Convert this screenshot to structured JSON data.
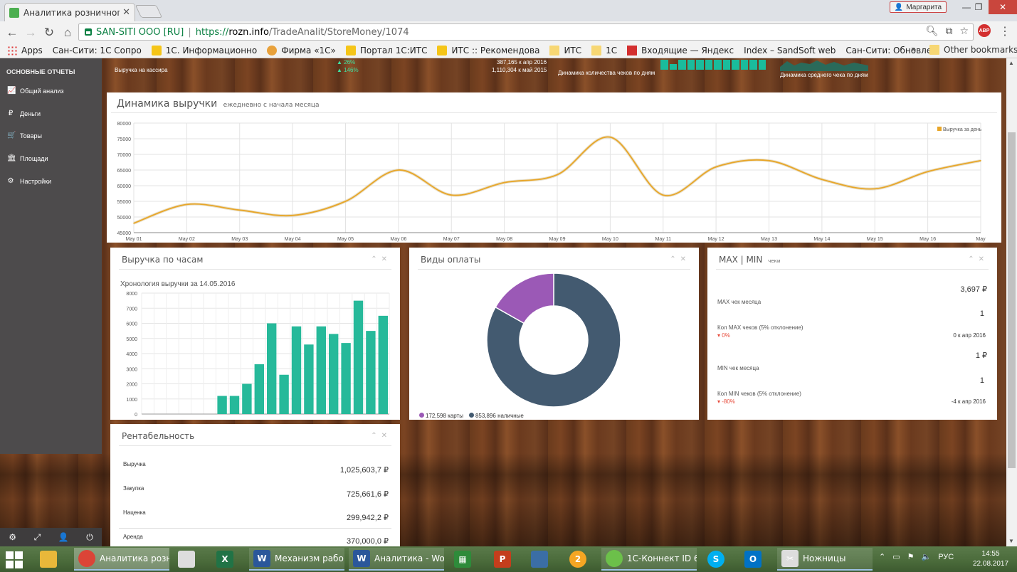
{
  "browser": {
    "tab_title": "Аналитика розничного",
    "user_name": "Маргарита",
    "site_identity": "SAN-SITI OOO [RU]",
    "url_protocol": "https://",
    "url_host": "rozn.info",
    "url_path": "/TradeAnalit/StoreMoney/1074",
    "bookmarks": [
      {
        "label": "Apps",
        "icon": "apps-icon"
      },
      {
        "label": "Сан-Сити: 1С Сопро",
        "icon": "page-icon"
      },
      {
        "label": "1С. Информационно",
        "icon": "its-icon"
      },
      {
        "label": "Фирма «1С»",
        "icon": "firm-icon"
      },
      {
        "label": "Портал 1С:ИТС",
        "icon": "its-icon"
      },
      {
        "label": "ИТС :: Рекомендова",
        "icon": "its-icon"
      },
      {
        "label": "ИТС",
        "icon": "folder-icon"
      },
      {
        "label": "1С",
        "icon": "folder-icon"
      },
      {
        "label": "Входящие — Яндекс",
        "icon": "mail-icon"
      },
      {
        "label": "Index – SandSoft web",
        "icon": "page-icon"
      },
      {
        "label": "Сан-Сити: Обновлен",
        "icon": "page-icon"
      }
    ],
    "more_label": "»",
    "other_bookmarks": "Other bookmarks"
  },
  "sidebar": {
    "title": "ОСНОВНЫЕ ОТЧЕТЫ",
    "items": [
      {
        "label": "Общий анализ",
        "icon": "chart-line-icon",
        "glyph": "📈"
      },
      {
        "label": "Деньги",
        "icon": "ruble-icon",
        "glyph": "₽"
      },
      {
        "label": "Товары",
        "icon": "cart-icon",
        "glyph": "🛒"
      },
      {
        "label": "Площади",
        "icon": "building-icon",
        "glyph": "🏛"
      },
      {
        "label": "Настройки",
        "icon": "gear-icon",
        "glyph": "⚙"
      }
    ],
    "bottom_icons": [
      "gear-icon",
      "fullscreen-icon",
      "user-icon",
      "power-icon"
    ]
  },
  "kpi": {
    "revenue_cashier_label": "Выручка на кассира",
    "pct1": "▲ 26%",
    "pct2": "▲ 146%",
    "cmp1": "387,165 к апр 2016",
    "cmp2": "1,110,304 к май 2015",
    "checks_label": "Динамика количества чеков по дням",
    "avg_check_label": "Динамика среднего чека по дням"
  },
  "revenue_chart": {
    "title": "Динамика выручки",
    "subtitle": "ежедневно с начала месяца"
  },
  "hourly_panel": {
    "title": "Выручка по часам",
    "chart_title": "Хронология выручки за 14.05.2016"
  },
  "payment_panel": {
    "title": "Виды оплаты",
    "legend": [
      {
        "label": "172,598 карты",
        "color": "#9b59b6"
      },
      {
        "label": "853,896 наличные",
        "color": "#435a70"
      }
    ]
  },
  "maxmin_panel": {
    "title": "MAX | MIN",
    "subtitle": "чеки",
    "max_value": "3,697 ₽",
    "max_label": "MAX чек месяца",
    "max_count": "1",
    "max_count_label": "Кол MAX чеков (5% отклонение)",
    "max_delta": "▾ 0%",
    "max_cmp": "0 к апр 2016",
    "min_value": "1 ₽",
    "min_label": "MIN чек месяца",
    "min_count": "1",
    "min_count_label": "Кол MIN чеков (5% отклонение)",
    "min_delta": "▾ -80%",
    "min_cmp": "-4 к апр 2016"
  },
  "rent_panel": {
    "title": "Рентабельность",
    "rows": [
      {
        "label": "Выручка",
        "value": "1,025,603,7 ₽"
      },
      {
        "label": "Закупка",
        "value": "725,661,6 ₽"
      },
      {
        "label": "Наценка",
        "value": "299,942,2 ₽"
      },
      {
        "label": "Аренда",
        "value": "370,000,0 ₽"
      }
    ]
  },
  "taskbar": {
    "items": [
      {
        "label": "Аналитика розн...",
        "icon": "chrome-icon",
        "color": "#db4437"
      },
      {
        "label": "Механизм рабо...",
        "icon": "word-icon",
        "color": "#2b579a"
      },
      {
        "label": "Аналитика - Wo...",
        "icon": "word-icon",
        "color": "#2b579a"
      },
      {
        "label": "1С-Коннект ID 6...",
        "icon": "connect-icon",
        "color": "#6cc04a"
      },
      {
        "label": "Ножницы",
        "icon": "scissors-icon",
        "color": "#c0392b"
      }
    ],
    "lang": "РУС",
    "time": "14:55",
    "date": "22.08.2017"
  },
  "chart_data": [
    {
      "type": "line",
      "title": "Динамика выручки",
      "subtitle": "ежедневно с начала месяца",
      "x": [
        "May 01",
        "May 02",
        "May 03",
        "May 04",
        "May 05",
        "May 06",
        "May 07",
        "May 08",
        "May 09",
        "May 10",
        "May 11",
        "May 12",
        "May 13",
        "May 14",
        "May 15",
        "May 16",
        "May"
      ],
      "series": [
        {
          "name": "Выручка за день",
          "color": "#e8a628",
          "values": [
            48000,
            54000,
            52200,
            50500,
            55000,
            65000,
            57000,
            61000,
            63500,
            75500,
            57000,
            66000,
            68000,
            62000,
            59000,
            64500,
            68000
          ]
        }
      ],
      "ylim": [
        45000,
        80000
      ],
      "yticks": [
        45000,
        50000,
        55000,
        60000,
        65000,
        70000,
        75000,
        80000
      ],
      "legend_position": "top-right",
      "grid": true
    },
    {
      "type": "bar",
      "title": "Хронология выручки за 14.05.2016",
      "color": "#26b99a",
      "values": [
        0,
        0,
        0,
        0,
        0,
        0,
        1200,
        1200,
        2000,
        3300,
        6000,
        2600,
        5800,
        4600,
        5800,
        5300,
        4700,
        7500,
        5500,
        6500
      ],
      "ylim": [
        0,
        8000
      ],
      "yticks": [
        0,
        1000,
        2000,
        3000,
        4000,
        5000,
        6000,
        7000,
        8000
      ],
      "grid": true
    },
    {
      "type": "pie",
      "title": "Виды оплаты",
      "donut": true,
      "slices": [
        {
          "label": "карты",
          "value": 172598,
          "color": "#9b59b6"
        },
        {
          "label": "наличные",
          "value": 853896,
          "color": "#435a70"
        }
      ]
    }
  ]
}
